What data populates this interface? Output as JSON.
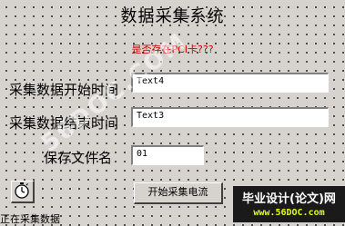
{
  "window": {
    "title": "数据采集系统",
    "warning": "是否存在PCI卡???",
    "status": "正在采集数据"
  },
  "form": {
    "start_time": {
      "label": "采集数据开始时间",
      "value": "Text4"
    },
    "end_time": {
      "label": "采集数据结束时间",
      "value": "Text3"
    },
    "file_name": {
      "label": "保存文件名",
      "value": "01"
    }
  },
  "actions": {
    "start_button": "开始采集电流",
    "timer_icon": "stopwatch-icon"
  },
  "watermark": {
    "text": "56DOC.COM",
    "logo_main": "毕业设计(论文)网",
    "logo_sub": "www.56DOC.com"
  },
  "colors": {
    "background": "#d6d3ce",
    "warning": "#d00000",
    "logo_bg": "#1a1a1a",
    "logo_sub": "#e0ff00"
  }
}
